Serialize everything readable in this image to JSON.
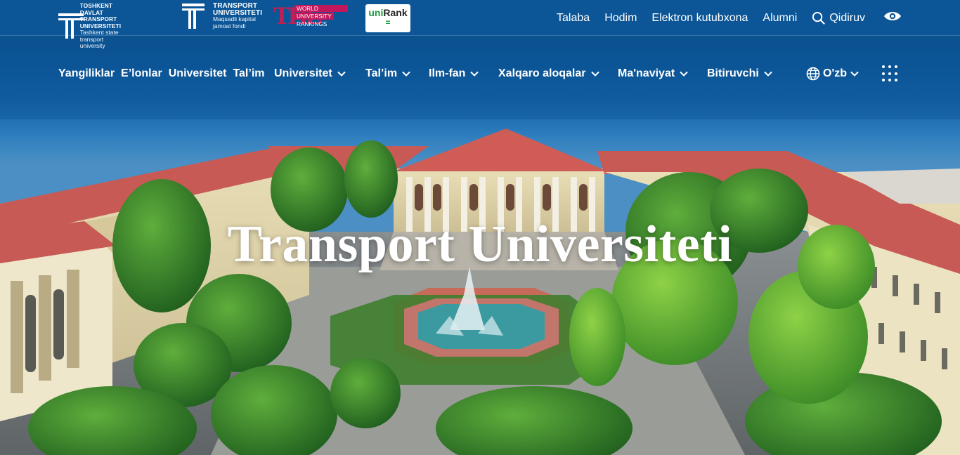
{
  "logos": {
    "tdtu": {
      "line1": "TOSHKENT DAVLAT",
      "line2": "TRANSPORT UNIVERSITETI",
      "line3": "Tashkent state",
      "line4": "transport university"
    },
    "fund": {
      "line1": "TRANSPORT",
      "line2": "UNIVERSITETI",
      "line3": "Maqsadli kapital",
      "line4": "jamoat fondi"
    },
    "the": {
      "mark": "THE",
      "line1": "WORLD",
      "line2": "UNIVERSITY",
      "line3": "RANKINGS"
    },
    "unirank": {
      "text_a": "uni",
      "text_b": "Rank",
      "mark": "="
    }
  },
  "top_links": {
    "student": "Talaba",
    "staff": "Hodim",
    "library": "Elektron kutubxona",
    "alumni": "Alumni",
    "search": "Qidiruv"
  },
  "icons": {
    "search": "search-icon",
    "accessibility": "eye-icon",
    "globe": "globe-icon",
    "apps": "grid-dots-icon",
    "chevron": "chevron-down-icon"
  },
  "main_nav": {
    "news": "Yangiliklar",
    "announcements": "E’lonlar",
    "university_link": "Universitet",
    "education_link": "Tal’im",
    "dropdowns": [
      {
        "label": "Universitet"
      },
      {
        "label": "Tal’im"
      },
      {
        "label": "Ilm-fan"
      },
      {
        "label": "Xalqaro aloqalar"
      },
      {
        "label": "Ma'naviyat"
      },
      {
        "label": "Bitiruvchi"
      }
    ],
    "language": "O'zb"
  },
  "hero": {
    "title": "Transport Universiteti"
  },
  "colors": {
    "topbar": "#0c5697",
    "roof": "#c85a55",
    "the_accent": "#c21e56",
    "unirank_green": "#1a9b3e"
  }
}
